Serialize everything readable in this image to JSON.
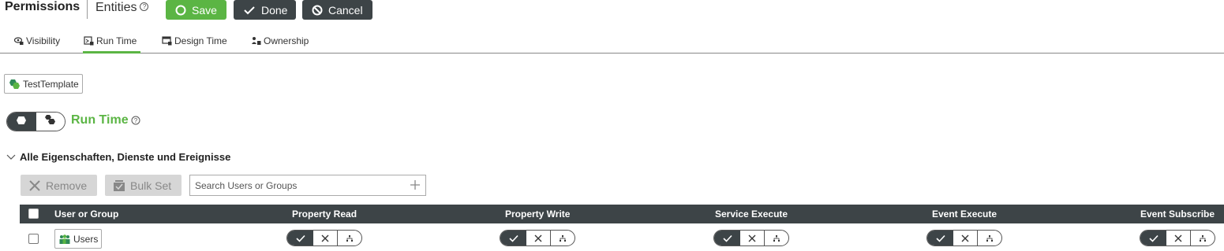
{
  "header": {
    "title": "Permissions",
    "subtitle": "Entities",
    "save_label": "Save",
    "done_label": "Done",
    "cancel_label": "Cancel",
    "save_color": "#5bb544",
    "dark_color": "#3d4447"
  },
  "tabs": [
    {
      "label": "Visibility",
      "icon": "eye-lock-icon"
    },
    {
      "label": "Run Time",
      "icon": "runtime-lock-icon",
      "active": true
    },
    {
      "label": "Design Time",
      "icon": "design-lock-icon"
    },
    {
      "label": "Ownership",
      "icon": "owner-icon"
    }
  ],
  "entity": {
    "label": "TestTemplate",
    "icon": "thing-template-icon"
  },
  "runtime": {
    "title": "Run Time",
    "accent": "#5bb544"
  },
  "section": {
    "title": "Alle Eigenschaften, Dienste und Ereignisse"
  },
  "actions": {
    "remove_label": "Remove",
    "bulk_label": "Bulk Set",
    "search_placeholder": "Search Users or Groups"
  },
  "table": {
    "columns": [
      "User or Group",
      "Property Read",
      "Property Write",
      "Service Execute",
      "Event Execute",
      "Event Subscribe"
    ],
    "rows": [
      {
        "name": "Users",
        "icon": "group-icon",
        "permissions": [
          "allow",
          "allow",
          "allow",
          "allow",
          "allow"
        ]
      }
    ]
  }
}
